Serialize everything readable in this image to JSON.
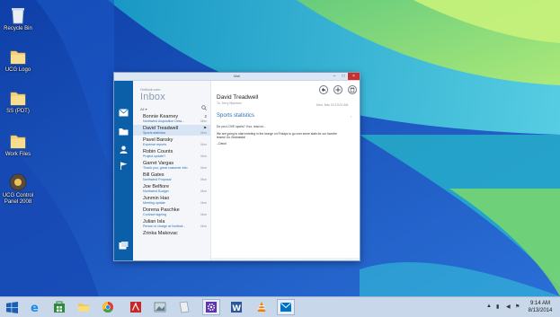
{
  "desktop": {
    "icons": [
      {
        "label": "Recycle Bin",
        "icon": "recycle-bin-icon"
      },
      {
        "label": "UCG Logo",
        "icon": "folder-icon"
      },
      {
        "label": "SS (PDT)",
        "icon": "folder-icon"
      },
      {
        "label": "Work Files",
        "icon": "folder-icon"
      },
      {
        "label": "UCG Control Panel 2008",
        "icon": "control-panel-icon"
      }
    ]
  },
  "mail_window": {
    "title": "Mail",
    "account": "Outlook.com",
    "folder": "Inbox",
    "filter": "All",
    "messages": [
      {
        "name": "Bonnie Kearney",
        "subject": "Northwind Acquisition Deta...",
        "date": "Mon",
        "flag": "2"
      },
      {
        "name": "David Treadwell",
        "subject": "Sports statistics",
        "date": "Mon",
        "flag": "⚑"
      },
      {
        "name": "Pavel Bansky",
        "subject": "Expense reports",
        "date": "Mon",
        "flag": ""
      },
      {
        "name": "Robin Counts",
        "subject": "Project update?",
        "date": "Mon",
        "flag": ""
      },
      {
        "name": "Garret Vargas",
        "subject": "Thank you, great customer info",
        "date": "Mon",
        "flag": ""
      },
      {
        "name": "Bill Gates",
        "subject": "Northwind Proposal",
        "date": "Mon",
        "flag": ""
      },
      {
        "name": "Joe Belfiore",
        "subject": "Northwind Budget",
        "date": "Mon",
        "flag": ""
      },
      {
        "name": "Junmin Hao",
        "subject": "Meeting update",
        "date": "Mon",
        "flag": ""
      },
      {
        "name": "Dorena Paschke",
        "subject": "Contract signing",
        "date": "Mon",
        "flag": ""
      },
      {
        "name": "Julian Isla",
        "subject": "Person in charge at Northwi...",
        "date": "Mon",
        "flag": ""
      },
      {
        "name": "Zrinka Makovac",
        "subject": "",
        "date": "",
        "flag": ""
      }
    ],
    "reading": {
      "from": "David Treadwell",
      "to": "To: Terry Myerson",
      "date": "Mon, Mar 24 10:01 AM",
      "subject": "Sports statistics",
      "body_lines": [
        "Do you LOVE sports? If so, read on...",
        "We are going to start meeting in the lounge on Fridays to go over some stats for our favorite",
        "teams! Go Seahawks!",
        "--David"
      ],
      "actions": [
        "reply-icon",
        "new-mail-icon",
        "delete-icon"
      ]
    }
  },
  "taskbar": {
    "items": [
      {
        "name": "internet-explorer",
        "color": "#1e88e5"
      },
      {
        "name": "store",
        "color": "#2e8b3a"
      },
      {
        "name": "file-explorer",
        "color": "#f2c94c"
      },
      {
        "name": "chrome",
        "color": "#e53935"
      },
      {
        "name": "acrobat",
        "color": "#c62828"
      },
      {
        "name": "image-viewer",
        "color": "#607d8b"
      },
      {
        "name": "notepad",
        "color": "#90a4ae"
      },
      {
        "name": "settings",
        "color": "#5e35b1"
      },
      {
        "name": "word",
        "color": "#2b579a"
      },
      {
        "name": "vlc",
        "color": "#f57c00"
      },
      {
        "name": "mail",
        "color": "#0072c6"
      }
    ],
    "time": "9:14 AM",
    "date": "8/13/2014"
  },
  "colors": {
    "mail_accent": "#0b5fa8",
    "taskbar_bg": "#c9d7ea",
    "wallpaper_blue": "#1e5fc0",
    "wallpaper_cyan": "#31c6d9",
    "wallpaper_green": "#86d66b"
  }
}
